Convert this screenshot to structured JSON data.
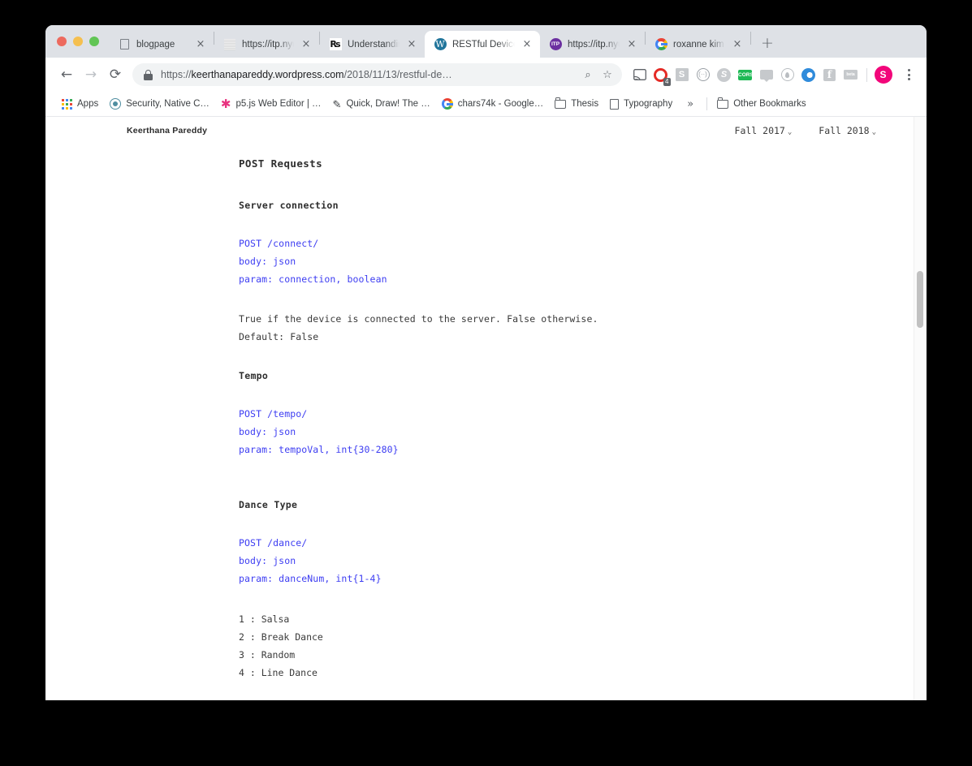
{
  "window": {
    "traffic_lights": [
      "close",
      "minimize",
      "maximize"
    ]
  },
  "tabs": [
    {
      "title": "blogpage",
      "favicon": "document-icon",
      "active": false,
      "close_label": "×"
    },
    {
      "title": "https://itp.nyu.e",
      "favicon": "noise-thumbnail-icon",
      "active": false,
      "close_label": "×"
    },
    {
      "title": "Understanding I",
      "favicon": "rupee-icon",
      "active": false,
      "close_label": "×"
    },
    {
      "title": "RESTful Device",
      "favicon": "wordpress-icon",
      "active": true,
      "close_label": "×"
    },
    {
      "title": "https://itp.nyu.e",
      "favicon": "itp-icon",
      "active": false,
      "close_label": "×"
    },
    {
      "title": "roxanne kim itp",
      "favicon": "google-icon",
      "active": false,
      "close_label": "×"
    }
  ],
  "new_tab_label": "+",
  "toolbar": {
    "back_label": "←",
    "forward_label": "→",
    "reload_label": "⟳",
    "url_scheme": "https://",
    "url_host": "keerthanapareddy.wordpress.com",
    "url_path": "/2018/11/13/restful-de…",
    "url_full": "https://keerthanapareddy.wordpress.com/2018/11/13/restful-de…",
    "search_label": "⌕",
    "bookmark_star_label": "☆",
    "cast_label": "◤",
    "profile_initial": "S",
    "extensions": [
      {
        "name": "opera-vpn-extension",
        "badge": "4"
      },
      {
        "name": "s-extension",
        "label": "S"
      },
      {
        "name": "dots-circle-extension",
        "label": "(··)"
      },
      {
        "name": "skype-extension",
        "label": "S"
      },
      {
        "name": "cors-extension",
        "label": "CORS"
      },
      {
        "name": "chat-extension",
        "label": ""
      },
      {
        "name": "water-drop-extension",
        "label": ""
      },
      {
        "name": "opera-touch-extension",
        "label": ""
      },
      {
        "name": "facebook-extension",
        "label": "f"
      },
      {
        "name": "grey-bar-extension",
        "label": "▬"
      }
    ]
  },
  "bookmarks": {
    "apps_label": "Apps",
    "items": [
      {
        "label": "Security, Native C…",
        "icon": "atom-icon"
      },
      {
        "label": "p5.js Web Editor | …",
        "icon": "star-icon"
      },
      {
        "label": "Quick, Draw! The …",
        "icon": "doodle-icon"
      },
      {
        "label": "chars74k - Google…",
        "icon": "google-icon"
      },
      {
        "label": "Thesis",
        "icon": "folder-icon"
      },
      {
        "label": "Typography",
        "icon": "document-icon"
      }
    ],
    "overflow_label": "»",
    "other_bookmarks_label": "Other Bookmarks"
  },
  "page": {
    "site_title": "Keerthana Pareddy",
    "nav": [
      {
        "label": "Fall 2017",
        "caret": "⌄"
      },
      {
        "label": "Fall 2018",
        "caret": "⌄"
      }
    ],
    "heading": "POST Requests",
    "sections": [
      {
        "subheading": "Server connection",
        "code": [
          "POST /connect/",
          "body: json",
          "param: connection, boolean"
        ],
        "text": [
          "True if the device is connected to the server. False otherwise.",
          "Default: False"
        ]
      },
      {
        "subheading": "Tempo",
        "code": [
          "POST /tempo/",
          "body: json",
          "param: tempoVal, int{30-280}"
        ],
        "text": []
      },
      {
        "subheading": "Dance Type",
        "code": [
          "POST /dance/",
          "body: json",
          "param: danceNum, int{1-4}"
        ],
        "text": []
      }
    ],
    "dance_list": [
      "1 : Salsa",
      "2 : Break Dance",
      "3 : Random",
      "4 : Line Dance"
    ]
  },
  "colors": {
    "code_blue": "#3d3df2",
    "tabstrip": "#dee1e6",
    "omnibox": "#f1f3f4",
    "accent_pink": "#f2067a"
  }
}
